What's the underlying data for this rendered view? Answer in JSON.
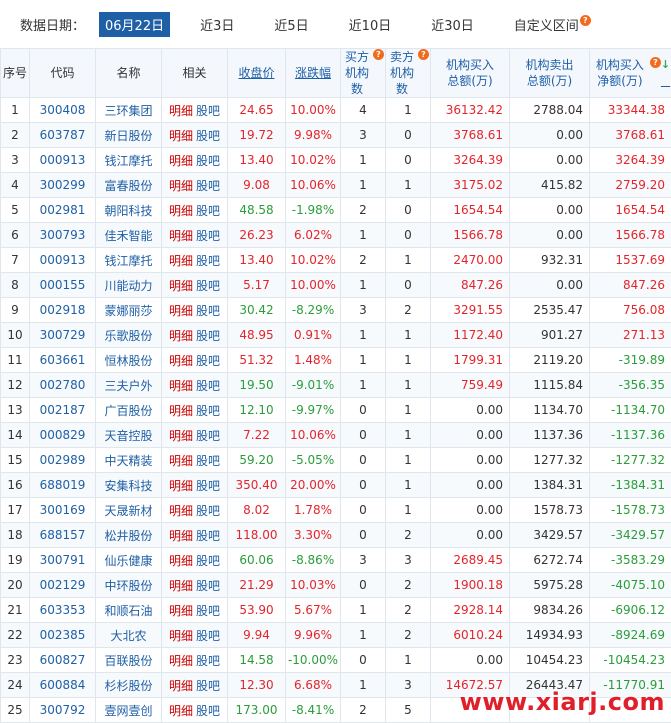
{
  "filter": {
    "label": "数据日期：",
    "options": [
      "06月22日",
      "近3日",
      "近5日",
      "近10日",
      "近30日",
      "自定义区间"
    ],
    "active_index": 0,
    "help_icon": "question-mark-icon"
  },
  "headers": {
    "seq": "序号",
    "code": "代码",
    "name": "名称",
    "related": "相关",
    "close": "收盘价",
    "change": "涨跌幅",
    "buy_count": "买方机构数",
    "sell_count": "卖方机构数",
    "buy_amount": "机构买入总额(万)",
    "sell_amount": "机构卖出总额(万)",
    "net_amount": "机构买入净额(万)"
  },
  "related_links": {
    "detail": "明细",
    "forum": "股吧"
  },
  "rows": [
    [
      "1",
      "300408",
      "三环集团",
      "24.65",
      "10.00%",
      "4",
      "1",
      "36132.42",
      "2788.04",
      "33344.38"
    ],
    [
      "2",
      "603787",
      "新日股份",
      "19.72",
      "9.98%",
      "3",
      "0",
      "3768.61",
      "0.00",
      "3768.61"
    ],
    [
      "3",
      "000913",
      "钱江摩托",
      "13.40",
      "10.02%",
      "1",
      "0",
      "3264.39",
      "0.00",
      "3264.39"
    ],
    [
      "4",
      "300299",
      "富春股份",
      "9.08",
      "10.06%",
      "1",
      "1",
      "3175.02",
      "415.82",
      "2759.20"
    ],
    [
      "5",
      "002981",
      "朝阳科技",
      "48.58",
      "-1.98%",
      "2",
      "0",
      "1654.54",
      "0.00",
      "1654.54"
    ],
    [
      "6",
      "300793",
      "佳禾智能",
      "26.23",
      "6.02%",
      "1",
      "0",
      "1566.78",
      "0.00",
      "1566.78"
    ],
    [
      "7",
      "000913",
      "钱江摩托",
      "13.40",
      "10.02%",
      "2",
      "1",
      "2470.00",
      "932.31",
      "1537.69"
    ],
    [
      "8",
      "000155",
      "川能动力",
      "5.17",
      "10.00%",
      "1",
      "0",
      "847.26",
      "0.00",
      "847.26"
    ],
    [
      "9",
      "002918",
      "蒙娜丽莎",
      "30.42",
      "-8.29%",
      "3",
      "2",
      "3291.55",
      "2535.47",
      "756.08"
    ],
    [
      "10",
      "300729",
      "乐歌股份",
      "48.95",
      "0.91%",
      "1",
      "1",
      "1172.40",
      "901.27",
      "271.13"
    ],
    [
      "11",
      "603661",
      "恒林股份",
      "51.32",
      "1.48%",
      "1",
      "1",
      "1799.31",
      "2119.20",
      "-319.89"
    ],
    [
      "12",
      "002780",
      "三夫户外",
      "19.50",
      "-9.01%",
      "1",
      "1",
      "759.49",
      "1115.84",
      "-356.35"
    ],
    [
      "13",
      "002187",
      "广百股份",
      "12.10",
      "-9.97%",
      "0",
      "1",
      "0.00",
      "1134.70",
      "-1134.70"
    ],
    [
      "14",
      "000829",
      "天音控股",
      "7.22",
      "10.06%",
      "0",
      "1",
      "0.00",
      "1137.36",
      "-1137.36"
    ],
    [
      "15",
      "002989",
      "中天精装",
      "59.20",
      "-5.05%",
      "0",
      "1",
      "0.00",
      "1277.32",
      "-1277.32"
    ],
    [
      "16",
      "688019",
      "安集科技",
      "350.40",
      "20.00%",
      "0",
      "1",
      "0.00",
      "1384.31",
      "-1384.31"
    ],
    [
      "17",
      "300169",
      "天晟新材",
      "8.02",
      "1.78%",
      "0",
      "1",
      "0.00",
      "1578.73",
      "-1578.73"
    ],
    [
      "18",
      "688157",
      "松井股份",
      "118.00",
      "3.30%",
      "0",
      "2",
      "0.00",
      "3429.57",
      "-3429.57"
    ],
    [
      "19",
      "300791",
      "仙乐健康",
      "60.06",
      "-8.86%",
      "3",
      "3",
      "2689.45",
      "6272.74",
      "-3583.29"
    ],
    [
      "20",
      "002129",
      "中环股份",
      "21.29",
      "10.03%",
      "0",
      "2",
      "1900.18",
      "5975.28",
      "-4075.10"
    ],
    [
      "21",
      "603353",
      "和顺石油",
      "53.90",
      "5.67%",
      "1",
      "2",
      "2928.14",
      "9834.26",
      "-6906.12"
    ],
    [
      "22",
      "002385",
      "大北农",
      "9.94",
      "9.96%",
      "1",
      "2",
      "6010.24",
      "14934.93",
      "-8924.69"
    ],
    [
      "23",
      "600827",
      "百联股份",
      "14.58",
      "-10.00%",
      "0",
      "1",
      "0.00",
      "10454.23",
      "-10454.23"
    ],
    [
      "24",
      "600884",
      "杉杉股份",
      "12.30",
      "6.68%",
      "1",
      "3",
      "14672.57",
      "26443.47",
      "-11770.91"
    ],
    [
      "25",
      "300792",
      "壹网壹创",
      "173.00",
      "-8.41%",
      "2",
      "5",
      "",
      "",
      ""
    ]
  ],
  "watermark": "www.xiarj.com",
  "colors": {
    "up": "#e4242b",
    "down": "#2a9d3a",
    "link": "#1f5fa6",
    "active_tab": "#1f5fa6"
  }
}
